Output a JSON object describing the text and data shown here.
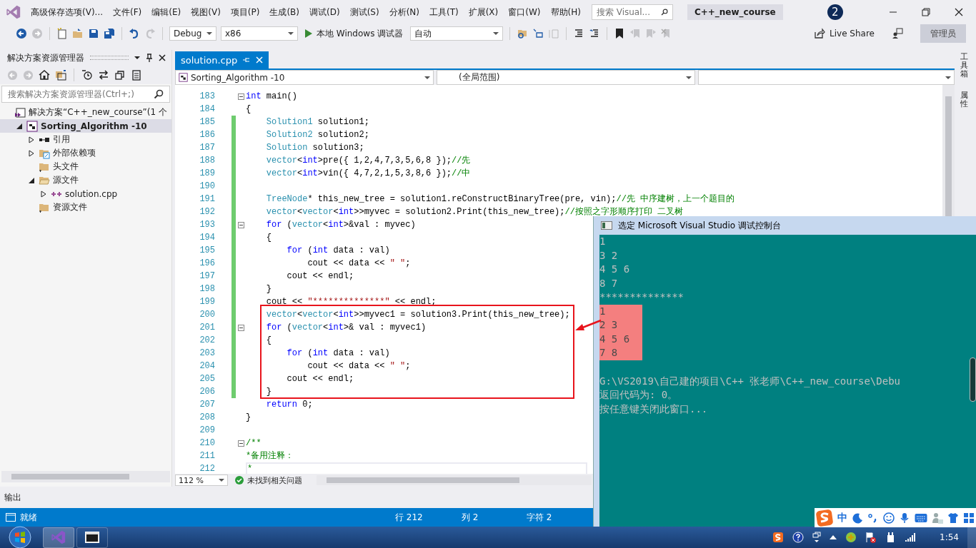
{
  "menu": {
    "title": "高级保存选项(V)...",
    "items": [
      "文件(F)",
      "编辑(E)",
      "视图(V)",
      "项目(P)",
      "生成(B)",
      "调试(D)",
      "测试(S)",
      "分析(N)",
      "工具(T)",
      "扩展(X)",
      "窗口(W)",
      "帮助(H)"
    ]
  },
  "title_bar": {
    "search_placeholder": "搜索 Visual...",
    "solution_name": "C++_new_course",
    "notifications": "2"
  },
  "toolbar": {
    "configuration": "Debug",
    "platform": "x86",
    "debugger": "本地 Windows 调试器",
    "run_mode": "自动",
    "live_share": "Live Share",
    "user": "管理员"
  },
  "solution_explorer": {
    "title": "解决方案资源管理器",
    "search_placeholder": "搜索解决方案资源管理器(Ctrl+;)",
    "tree": [
      {
        "label": "解决方案“C++_new_course”(1 个",
        "kind": "solution",
        "selected": false,
        "children": [
          {
            "label": "Sorting_Algorithm -10",
            "kind": "project",
            "selected": true,
            "expanded": true,
            "children": [
              {
                "label": "引用",
                "kind": "references",
                "selected": false,
                "expanded": false
              },
              {
                "label": "外部依赖项",
                "kind": "external",
                "selected": false,
                "expanded": false
              },
              {
                "label": "头文件",
                "kind": "folder",
                "selected": false
              },
              {
                "label": "源文件",
                "kind": "folder",
                "selected": false,
                "expanded": true,
                "children": [
                  {
                    "label": "solution.cpp",
                    "kind": "cpp",
                    "selected": false,
                    "expanded": false
                  }
                ]
              },
              {
                "label": "资源文件",
                "kind": "folder",
                "selected": false
              }
            ]
          }
        ]
      }
    ]
  },
  "editor": {
    "tabs": [
      {
        "label": "solution.cpp",
        "selected": true
      }
    ],
    "project_scope": "Sorting_Algorithm -10",
    "scope": "(全局范围)",
    "zoom": "112 %",
    "issues": "未找到相关问题",
    "lines": [
      {
        "number": "183",
        "changed": false,
        "fold": true,
        "current": false,
        "tokens": [
          {
            "kind": "kw",
            "text": "int"
          },
          {
            "kind": "plain",
            "text": " main()"
          }
        ]
      },
      {
        "number": "184",
        "changed": false,
        "fold": false,
        "current": false,
        "tokens": [
          {
            "kind": "plain",
            "text": "{"
          }
        ]
      },
      {
        "number": "185",
        "changed": true,
        "fold": false,
        "current": false,
        "tokens": [
          {
            "kind": "type",
            "text": "    Solution1"
          },
          {
            "kind": "plain",
            "text": " solution1;"
          }
        ]
      },
      {
        "number": "186",
        "changed": true,
        "fold": false,
        "current": false,
        "tokens": [
          {
            "kind": "type",
            "text": "    Solution2"
          },
          {
            "kind": "plain",
            "text": " solution2;"
          }
        ]
      },
      {
        "number": "187",
        "changed": true,
        "fold": false,
        "current": false,
        "tokens": [
          {
            "kind": "type",
            "text": "    Solution"
          },
          {
            "kind": "plain",
            "text": " solution3;"
          }
        ]
      },
      {
        "number": "188",
        "changed": true,
        "fold": false,
        "current": false,
        "tokens": [
          {
            "kind": "type",
            "text": "    vector"
          },
          {
            "kind": "plain",
            "text": "<"
          },
          {
            "kind": "kw",
            "text": "int"
          },
          {
            "kind": "plain",
            "text": ">pre({ 1,2,4,7,3,5,6,8 });"
          },
          {
            "kind": "comment",
            "text": "//先"
          }
        ]
      },
      {
        "number": "189",
        "changed": true,
        "fold": false,
        "current": false,
        "tokens": [
          {
            "kind": "type",
            "text": "    vector"
          },
          {
            "kind": "plain",
            "text": "<"
          },
          {
            "kind": "kw",
            "text": "int"
          },
          {
            "kind": "plain",
            "text": ">vin({ 4,7,2,1,5,3,8,6 });"
          },
          {
            "kind": "comment",
            "text": "//中"
          }
        ]
      },
      {
        "number": "190",
        "changed": true,
        "fold": false,
        "current": false
      },
      {
        "number": "191",
        "changed": true,
        "fold": false,
        "current": false,
        "tokens": [
          {
            "kind": "type",
            "text": "    TreeNode"
          },
          {
            "kind": "plain",
            "text": "* this_new_tree = solution1.reConstructBinaryTree(pre, vin);"
          },
          {
            "kind": "comment",
            "text": "//先 中序建树，上一个题目的"
          }
        ]
      },
      {
        "number": "192",
        "changed": true,
        "fold": false,
        "current": false,
        "tokens": [
          {
            "kind": "type",
            "text": "    vector"
          },
          {
            "kind": "plain",
            "text": "<"
          },
          {
            "kind": "type",
            "text": "vector"
          },
          {
            "kind": "plain",
            "text": "<"
          },
          {
            "kind": "kw",
            "text": "int"
          },
          {
            "kind": "plain",
            "text": ">>myvec = solution2.Print(this_new_tree);"
          },
          {
            "kind": "comment",
            "text": "//按照之字形顺序打印 二叉树"
          }
        ]
      },
      {
        "number": "193",
        "changed": true,
        "fold": true,
        "current": false,
        "tokens": [
          {
            "kind": "kw",
            "text": "    for"
          },
          {
            "kind": "plain",
            "text": " ("
          },
          {
            "kind": "type",
            "text": "vector"
          },
          {
            "kind": "plain",
            "text": "<"
          },
          {
            "kind": "kw",
            "text": "int"
          },
          {
            "kind": "plain",
            "text": ">&val : myvec)"
          }
        ]
      },
      {
        "number": "194",
        "changed": true,
        "fold": false,
        "current": false,
        "tokens": [
          {
            "kind": "plain",
            "text": "    {"
          }
        ]
      },
      {
        "number": "195",
        "changed": true,
        "fold": false,
        "current": false,
        "tokens": [
          {
            "kind": "kw",
            "text": "        for"
          },
          {
            "kind": "plain",
            "text": " ("
          },
          {
            "kind": "kw",
            "text": "int"
          },
          {
            "kind": "plain",
            "text": " data : val)"
          }
        ]
      },
      {
        "number": "196",
        "changed": true,
        "fold": false,
        "current": false,
        "tokens": [
          {
            "kind": "plain",
            "text": "            cout << data << "
          },
          {
            "kind": "str",
            "text": "\" \""
          },
          {
            "kind": "plain",
            "text": ";"
          }
        ]
      },
      {
        "number": "197",
        "changed": true,
        "fold": false,
        "current": false,
        "tokens": [
          {
            "kind": "plain",
            "text": "        cout << endl;"
          }
        ]
      },
      {
        "number": "198",
        "changed": true,
        "fold": false,
        "current": false,
        "tokens": [
          {
            "kind": "plain",
            "text": "    }"
          }
        ]
      },
      {
        "number": "199",
        "changed": true,
        "fold": false,
        "current": false,
        "tokens": [
          {
            "kind": "plain",
            "text": "    cout << "
          },
          {
            "kind": "str",
            "text": "\"**************\""
          },
          {
            "kind": "plain",
            "text": " << endl;"
          }
        ]
      },
      {
        "number": "200",
        "changed": true,
        "fold": false,
        "current": false,
        "tokens": [
          {
            "kind": "type",
            "text": "    vector"
          },
          {
            "kind": "plain",
            "text": "<"
          },
          {
            "kind": "type",
            "text": "vector"
          },
          {
            "kind": "plain",
            "text": "<"
          },
          {
            "kind": "kw",
            "text": "int"
          },
          {
            "kind": "plain",
            "text": ">>myvec1 = solution3.Print(this_new_tree);"
          }
        ]
      },
      {
        "number": "201",
        "changed": true,
        "fold": true,
        "current": false,
        "tokens": [
          {
            "kind": "kw",
            "text": "    for"
          },
          {
            "kind": "plain",
            "text": " ("
          },
          {
            "kind": "type",
            "text": "vector"
          },
          {
            "kind": "plain",
            "text": "<"
          },
          {
            "kind": "kw",
            "text": "int"
          },
          {
            "kind": "plain",
            "text": ">& val : myvec1)"
          }
        ]
      },
      {
        "number": "202",
        "changed": true,
        "fold": false,
        "current": false,
        "tokens": [
          {
            "kind": "plain",
            "text": "    {"
          }
        ]
      },
      {
        "number": "203",
        "changed": true,
        "fold": false,
        "current": false,
        "tokens": [
          {
            "kind": "kw",
            "text": "        for"
          },
          {
            "kind": "plain",
            "text": " ("
          },
          {
            "kind": "kw",
            "text": "int"
          },
          {
            "kind": "plain",
            "text": " data : val)"
          }
        ]
      },
      {
        "number": "204",
        "changed": true,
        "fold": false,
        "current": false,
        "tokens": [
          {
            "kind": "plain",
            "text": "            cout << data << "
          },
          {
            "kind": "str",
            "text": "\" \""
          },
          {
            "kind": "plain",
            "text": ";"
          }
        ]
      },
      {
        "number": "205",
        "changed": true,
        "fold": false,
        "current": false,
        "tokens": [
          {
            "kind": "plain",
            "text": "        cout << endl;"
          }
        ]
      },
      {
        "number": "206",
        "changed": true,
        "fold": false,
        "current": false,
        "tokens": [
          {
            "kind": "plain",
            "text": "    }"
          }
        ]
      },
      {
        "number": "207",
        "changed": false,
        "fold": false,
        "current": false,
        "tokens": [
          {
            "kind": "kw",
            "text": "    return"
          },
          {
            "kind": "plain",
            "text": " 0;"
          }
        ]
      },
      {
        "number": "208",
        "changed": false,
        "fold": false,
        "current": false,
        "tokens": [
          {
            "kind": "plain",
            "text": "}"
          }
        ]
      },
      {
        "number": "209",
        "changed": false,
        "fold": false,
        "current": false
      },
      {
        "number": "210",
        "changed": false,
        "fold": true,
        "current": false,
        "tokens": [
          {
            "kind": "comment",
            "text": "/**"
          }
        ]
      },
      {
        "number": "211",
        "changed": false,
        "fold": false,
        "current": false,
        "tokens": [
          {
            "kind": "comment",
            "text": "*备用注释："
          }
        ]
      },
      {
        "number": "212",
        "changed": false,
        "fold": false,
        "current": true,
        "tokens": [
          {
            "kind": "comment",
            "text": "*"
          }
        ]
      }
    ]
  },
  "dock_tabs": [
    "工具箱",
    "属性"
  ],
  "output_panel": {
    "title": "输出"
  },
  "status_bar": {
    "state": "就绪",
    "line": "行 212",
    "column": "列 2",
    "char": "字符 2"
  },
  "console": {
    "title": "选定 Microsoft Visual Studio 调试控制台",
    "lines": [
      {
        "text": "1",
        "highlighted": false
      },
      {
        "text": "3 2",
        "highlighted": false
      },
      {
        "text": "4 5 6",
        "highlighted": false
      },
      {
        "text": "8 7",
        "highlighted": false
      },
      {
        "text": "**************",
        "highlighted": false
      },
      {
        "text": "1",
        "highlighted": true
      },
      {
        "text": "2 3",
        "highlighted": true
      },
      {
        "text": "4 5 6",
        "highlighted": true
      },
      {
        "text": "7 8",
        "highlighted": true
      }
    ],
    "messages": [
      "G:\\VS2019\\自己建的项目\\C++ 张老师\\C++_new_course\\Debu",
      "返回代码为: 0。",
      "按任意键关闭此窗口..."
    ]
  },
  "ime_bar": {
    "mode": "中"
  },
  "taskbar": {
    "time": "1:54"
  }
}
